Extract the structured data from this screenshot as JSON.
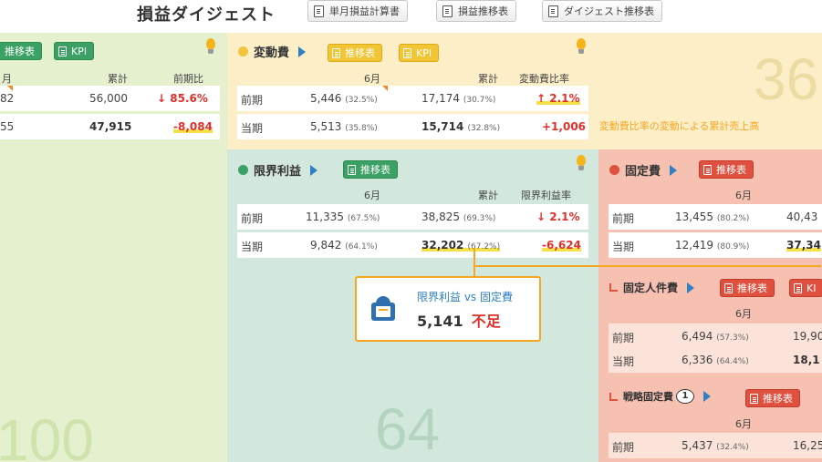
{
  "header": {
    "title": "損益ダイジェスト",
    "buttons": [
      "単月損益計算書",
      "損益推移表",
      "ダイジェスト推移表"
    ]
  },
  "sales": {
    "tags": [
      "推移表",
      "KPI"
    ],
    "cols": [
      "月",
      "累計",
      "前期比"
    ],
    "prev_row": {
      "month": "82",
      "cumulative": "56,000",
      "ratio": "85.6%",
      "ratio_arrow": "↓"
    },
    "curr_row": {
      "month": "55",
      "cumulative": "47,915",
      "ratio": "-8,084"
    },
    "big_number": "100"
  },
  "variable_cost": {
    "title": "変動費",
    "tags": [
      "推移表",
      "KPI"
    ],
    "cols": [
      "6月",
      "累計",
      "変動費比率"
    ],
    "rows": [
      {
        "label": "前期",
        "month": "5,446",
        "month_pct": "(32.5%)",
        "cumulative": "17,174",
        "cum_pct": "(30.7%)",
        "ratio": "2.1%",
        "ratio_arrow": "↑"
      },
      {
        "label": "当期",
        "month": "5,513",
        "month_pct": "(35.8%)",
        "cumulative": "15,714",
        "cum_pct": "(32.8%)",
        "ratio": "+1,006"
      }
    ],
    "note": "変動費比率の変動による累計売上高",
    "big_number": "36"
  },
  "marginal_profit": {
    "title": "限界利益",
    "tags": [
      "推移表"
    ],
    "cols": [
      "6月",
      "累計",
      "限界利益率"
    ],
    "rows": [
      {
        "label": "前期",
        "month": "11,335",
        "month_pct": "(67.5%)",
        "cumulative": "38,825",
        "cum_pct": "(69.3%)",
        "ratio": "2.1%",
        "ratio_arrow": "↓"
      },
      {
        "label": "当期",
        "month": "9,842",
        "month_pct": "(64.1%)",
        "cumulative": "32,202",
        "cum_pct": "(67.2%)",
        "ratio": "-6,624"
      }
    ],
    "big_number": "64"
  },
  "callout": {
    "title": "限界利益 vs 固定費",
    "value": "5,141",
    "status": "不足"
  },
  "fixed_cost": {
    "title": "固定費",
    "tags": [
      "推移表"
    ],
    "cols": [
      "6月"
    ],
    "rows": [
      {
        "label": "前期",
        "month": "13,455",
        "month_pct": "(80.2%)",
        "cumulative": "40,43"
      },
      {
        "label": "当期",
        "month": "12,419",
        "month_pct": "(80.9%)",
        "cumulative": "37,34"
      }
    ],
    "personnel": {
      "title": "固定人件費",
      "tags": [
        "推移表",
        "KI"
      ],
      "col": "6月",
      "rows": [
        {
          "label": "前期",
          "month": "6,494",
          "month_pct": "(57.3%)",
          "cumulative": "19,90"
        },
        {
          "label": "当期",
          "month": "6,336",
          "month_pct": "(64.4%)",
          "cumulative": "18,1"
        }
      ]
    },
    "strategic": {
      "title": "戦略固定費",
      "badge": "1",
      "tags": [
        "推移表"
      ],
      "col": "6月",
      "rows": [
        {
          "label": "前期",
          "month": "5,437",
          "month_pct": "(32.4%)",
          "cumulative": "16,25"
        }
      ]
    }
  },
  "colors": {
    "sales_bg": "#e5f0cf",
    "variable_bg": "#fcefc8",
    "marginal_bg": "#d3e8dc",
    "fixed_bg": "#f6c1b0",
    "accent_orange": "#f5a623",
    "negative_red": "#e0302a"
  }
}
